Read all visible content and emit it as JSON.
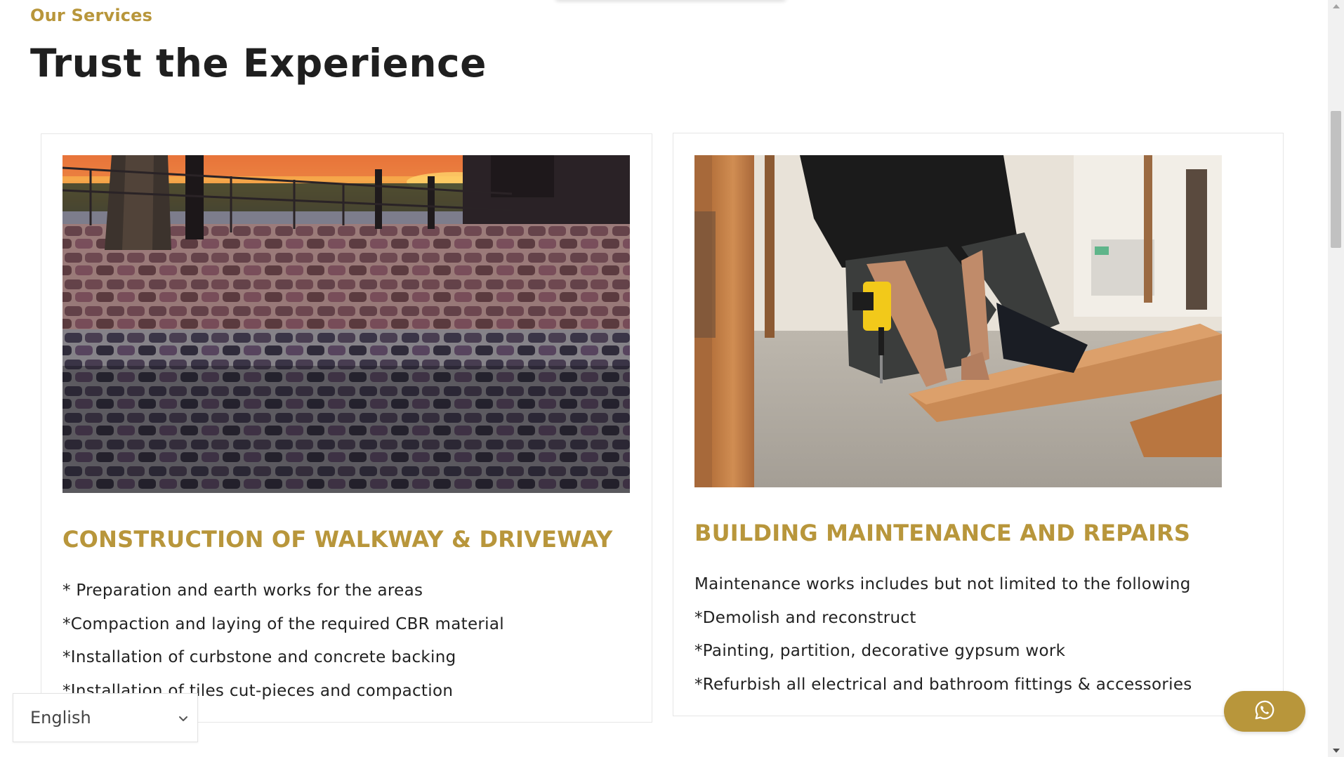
{
  "section": {
    "eyebrow": "Our Services",
    "title": "Trust the Experience"
  },
  "cards": [
    {
      "image_alt": "Cobblestone walkway at sunset",
      "heading": "CONSTRUCTION OF WALKWAY & DRIVEWAY",
      "items": [
        "* Preparation and earth works for the areas",
        "*Compaction and laying of the required CBR material",
        "*Installation of curbstone and concrete backing",
        "*Installation of tiles cut-pieces and compaction"
      ]
    },
    {
      "image_alt": "Worker drilling into a wooden plank",
      "heading": "BUILDING MAINTENANCE AND REPAIRS",
      "items": [
        "Maintenance works includes but not limited to the following",
        "*Demolish and reconstruct",
        "*Painting, partition, decorative gypsum work",
        "*Refurbish all electrical and bathroom fittings & accessories"
      ]
    }
  ],
  "language_select": {
    "value": "English"
  },
  "icons": {
    "language_chevron": "chevron-down-icon",
    "chat": "whatsapp-icon",
    "scroll_up": "scroll-up-arrow-icon",
    "scroll_down": "scroll-down-arrow-icon"
  },
  "colors": {
    "accent": "#b8963b",
    "heading": "#1f1f1f",
    "body_text": "#222222"
  }
}
